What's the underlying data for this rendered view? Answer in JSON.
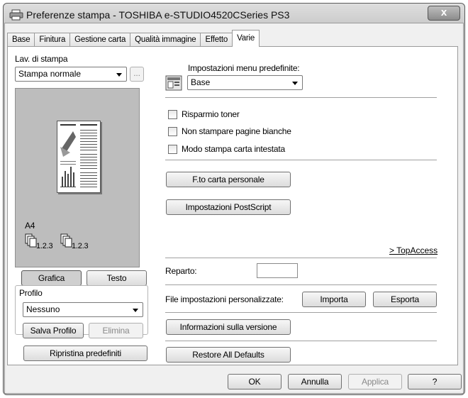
{
  "window": {
    "title": "Preferenze stampa - TOSHIBA e-STUDIO4520CSeries PS3",
    "close_label": "x"
  },
  "tabs": [
    {
      "label": "Base",
      "active": false
    },
    {
      "label": "Finitura",
      "active": false
    },
    {
      "label": "Gestione carta",
      "active": false
    },
    {
      "label": "Qualità immagine",
      "active": false
    },
    {
      "label": "Effetto",
      "active": false
    },
    {
      "label": "Varie",
      "active": true
    }
  ],
  "left": {
    "job_label": "Lav. di stampa",
    "job_value": "Stampa normale",
    "more_label": "...",
    "paper_size": "A4",
    "copy1": "1.2.3",
    "copy2": "1.2.3",
    "grafica_label": "Grafica",
    "testo_label": "Testo",
    "profile_label": "Profilo",
    "profile_value": "Nessuno",
    "save_profile_label": "Salva Profilo",
    "delete_label": "Elimina",
    "restore_defaults_label": "Ripristina predefiniti"
  },
  "right": {
    "menu_defaults_label": "Impostazioni menu predefinite:",
    "menu_defaults_value": "Base",
    "toner_saving": "Risparmio toner",
    "no_blank_pages": "Non stampare pagine bianche",
    "letterhead_mode": "Modo stampa carta intestata",
    "custom_paper_label": "F.to carta personale",
    "postscript_label": "Impostazioni PostScript",
    "top_access_label": "> TopAccess",
    "department_label": "Reparto:",
    "custom_file_label": "File impostazioni personalizzate:",
    "import_label": "Importa",
    "export_label": "Esporta",
    "version_info_label": "Informazioni sulla versione",
    "restore_all_label": "Restore All Defaults"
  },
  "footer": {
    "ok_label": "OK",
    "cancel_label": "Annulla",
    "apply_label": "Applica",
    "help_label": "?"
  },
  "icons": {
    "window": "printer-icon",
    "menu_defaults": "settings-sheet-icon",
    "copy": "collated-copies-icon"
  }
}
